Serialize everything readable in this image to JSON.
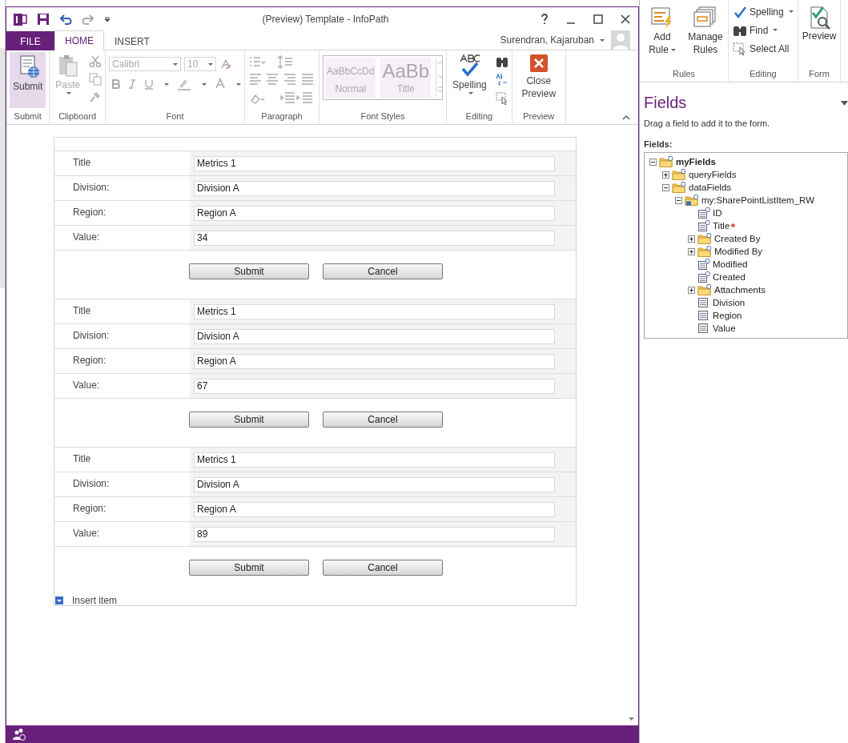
{
  "window": {
    "title": "(Preview) Template - InfoPath",
    "user_name": "Surendran, Kajaruban"
  },
  "tabs": [
    {
      "label": "FILE",
      "kind": "file",
      "selected": false
    },
    {
      "label": "HOME",
      "kind": "tab",
      "selected": true
    },
    {
      "label": "INSERT",
      "kind": "tab",
      "selected": false
    }
  ],
  "ribbon": {
    "submit": {
      "label": "Submit",
      "group": "Submit"
    },
    "clipboard": {
      "paste": "Paste",
      "group": "Clipboard",
      "disabled": true
    },
    "font": {
      "family": "Calibri",
      "size": "10",
      "group": "Font",
      "disabled": true
    },
    "paragraph": {
      "group": "Paragraph",
      "disabled": true
    },
    "font_styles": {
      "group": "Font Styles",
      "disabled": true,
      "styles": [
        {
          "sample": "AaBbCcDd",
          "name": "Normal"
        },
        {
          "sample": "AaBb",
          "name": "Title"
        }
      ]
    },
    "editing": {
      "spelling": "Spelling",
      "group": "Editing"
    },
    "preview": {
      "close": "Close Preview",
      "group": "Preview"
    }
  },
  "form": {
    "records": [
      {
        "fields": [
          {
            "label": "Title",
            "value": "Metrics 1"
          },
          {
            "label": "Division:",
            "value": "Division A"
          },
          {
            "label": "Region:",
            "value": "Region A"
          },
          {
            "label": "Value:",
            "value": "34"
          }
        ],
        "buttons": [
          "Submit",
          "Cancel"
        ]
      },
      {
        "fields": [
          {
            "label": "Title",
            "value": "Metrics 1"
          },
          {
            "label": "Division:",
            "value": "Division A"
          },
          {
            "label": "Region:",
            "value": "Region A"
          },
          {
            "label": "Value:",
            "value": "67"
          }
        ],
        "buttons": [
          "Submit",
          "Cancel"
        ]
      },
      {
        "fields": [
          {
            "label": "Title",
            "value": "Metrics 1"
          },
          {
            "label": "Division:",
            "value": "Division A"
          },
          {
            "label": "Region:",
            "value": "Region A"
          },
          {
            "label": "Value:",
            "value": "89"
          }
        ],
        "buttons": [
          "Submit",
          "Cancel"
        ]
      }
    ],
    "insert_item": "Insert item"
  },
  "designer_ribbon": {
    "rules": {
      "add_rule": "Add Rule",
      "manage_rules": "Manage Rules",
      "group": "Rules"
    },
    "editing": {
      "spelling": "Spelling",
      "find": "Find",
      "select_all": "Select All",
      "group": "Editing"
    },
    "form": {
      "preview": "Preview",
      "group": "Form"
    }
  },
  "fields_pane": {
    "title": "Fields",
    "description": "Drag a field to add it to the form.",
    "list_label": "Fields:",
    "tree": [
      {
        "name": "myFields",
        "kind": "group",
        "expanded": true,
        "required": false,
        "children": [
          {
            "name": "queryFields",
            "kind": "group",
            "expanded": false,
            "required": false
          },
          {
            "name": "dataFields",
            "kind": "group",
            "expanded": true,
            "required": false,
            "children": [
              {
                "name": "my:SharePointListItem_RW",
                "kind": "repeating",
                "expanded": true,
                "required": false,
                "children": [
                  {
                    "name": "ID",
                    "kind": "locked-field",
                    "required": false
                  },
                  {
                    "name": "Title",
                    "kind": "locked-field",
                    "required": true
                  },
                  {
                    "name": "Created By",
                    "kind": "group",
                    "expanded": false,
                    "required": false
                  },
                  {
                    "name": "Modified By",
                    "kind": "group",
                    "expanded": false,
                    "required": false
                  },
                  {
                    "name": "Modified",
                    "kind": "locked-field",
                    "required": false
                  },
                  {
                    "name": "Created",
                    "kind": "locked-field",
                    "required": false
                  },
                  {
                    "name": "Attachments",
                    "kind": "group",
                    "expanded": false,
                    "required": false
                  },
                  {
                    "name": "Division",
                    "kind": "field",
                    "required": false
                  },
                  {
                    "name": "Region",
                    "kind": "field",
                    "required": false
                  },
                  {
                    "name": "Value",
                    "kind": "field",
                    "required": false
                  }
                ]
              }
            ]
          }
        ]
      }
    ]
  }
}
